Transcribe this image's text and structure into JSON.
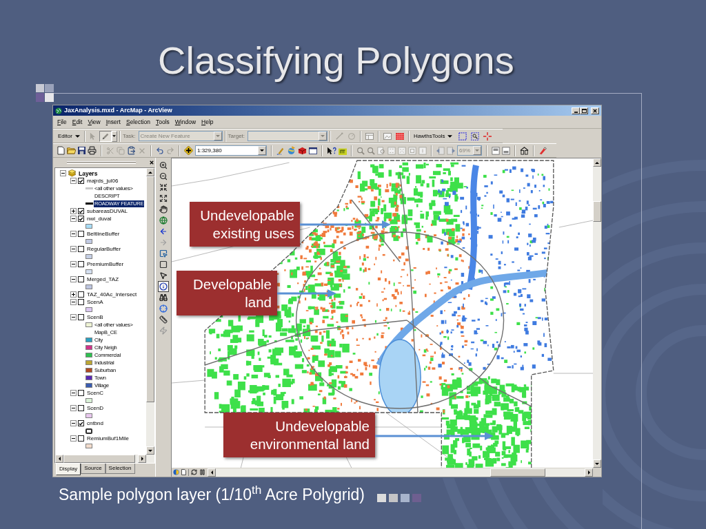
{
  "slide": {
    "title": "Classifying Polygons",
    "caption": "Sample polygon layer (1/10$^{th}$ Acre Polygrid)"
  },
  "window": {
    "title": "JaxAnalysis.mxd - ArcMap - ArcView"
  },
  "menu": [
    "File",
    "Edit",
    "View",
    "Insert",
    "Selection",
    "Tools",
    "Window",
    "Help"
  ],
  "editor_toolbar": {
    "editor": "Editor",
    "task": {
      "label": "Task:",
      "value": "Create New Feature",
      "disabled": true
    },
    "target": {
      "label": "Target:",
      "disabled": true
    },
    "hawths_tools": "HawthsTools"
  },
  "standard_toolbar": {
    "scale": "1:329,380",
    "zoom": {
      "value": "69%",
      "disabled": true
    }
  },
  "toc": {
    "root": {
      "label": "Layers",
      "expanded": true,
      "children": [
        {
          "label": "majrds_jul06",
          "checked": true,
          "expanded": true,
          "legend": [
            {
              "kind": "line",
              "label": "<all other values>",
              "color": "#c8c8c8",
              "selected": false
            },
            {
              "kind": "heading",
              "label": "DESCRIPT",
              "selected": false
            },
            {
              "kind": "line",
              "label": "ROADWAY FEATURE",
              "color": "#000000",
              "selected": true
            }
          ]
        },
        {
          "label": "subareasDUVAL",
          "checked": true,
          "expanded": false
        },
        {
          "label": "nwi_duval",
          "checked": true,
          "expanded": true,
          "legend": [
            {
              "kind": "fill",
              "color": "#a8dcf6",
              "selected": false
            }
          ]
        },
        {
          "label": "BeltlineBuffer",
          "checked": false,
          "expanded": true,
          "legend": [
            {
              "kind": "fill",
              "color": "#c2cbe4",
              "selected": false
            }
          ]
        },
        {
          "label": "RegularBuffer",
          "checked": false,
          "expanded": true,
          "legend": [
            {
              "kind": "fill",
              "color": "#c6d0e6",
              "selected": false
            }
          ]
        },
        {
          "label": "PremiumBuffer",
          "checked": false,
          "expanded": true,
          "legend": [
            {
              "kind": "fill",
              "color": "#d4dff0",
              "selected": false
            }
          ]
        },
        {
          "label": "Merged_TAZ",
          "checked": false,
          "expanded": true,
          "legend": [
            {
              "kind": "fill",
              "color": "#bdc5e0",
              "selected": false
            }
          ]
        },
        {
          "label": "TAZ_40Ac_Intersect",
          "checked": false,
          "expanded": false
        },
        {
          "label": "ScenA",
          "checked": false,
          "expanded": true,
          "legend": [
            {
              "kind": "fill",
              "color": "#dcc8f2",
              "selected": false
            }
          ]
        },
        {
          "label": "ScenB",
          "checked": false,
          "expanded": true,
          "legend": [
            {
              "kind": "fill",
              "label": "<all other values>",
              "color": "#eef3d4",
              "selected": false
            },
            {
              "kind": "heading",
              "label": "MapB_CE",
              "selected": false
            },
            {
              "kind": "fill",
              "label": "City",
              "color": "#2aa0c0",
              "selected": false
            },
            {
              "kind": "fill",
              "label": "City Neigh",
              "color": "#d0348a",
              "selected": false
            },
            {
              "kind": "fill",
              "label": "Commercial",
              "color": "#2ec050",
              "selected": false
            },
            {
              "kind": "fill",
              "label": "Industrial",
              "color": "#bca634",
              "selected": false
            },
            {
              "kind": "fill",
              "label": "Suburban",
              "color": "#b04a22",
              "selected": false
            },
            {
              "kind": "fill",
              "label": "Town",
              "color": "#5a28b4",
              "selected": false
            },
            {
              "kind": "fill",
              "label": "Village",
              "color": "#3a5cb0",
              "selected": false
            }
          ]
        },
        {
          "label": "ScenC",
          "checked": false,
          "expanded": true,
          "legend": [
            {
              "kind": "fill",
              "color": "#daf2d8",
              "selected": false
            }
          ]
        },
        {
          "label": "ScenD",
          "checked": false,
          "expanded": true,
          "legend": [
            {
              "kind": "fill",
              "color": "#e8c8ee",
              "selected": false
            }
          ]
        },
        {
          "label": "cntbnd",
          "checked": true,
          "expanded": true,
          "legend": [
            {
              "kind": "outline",
              "selected": false
            }
          ]
        },
        {
          "label": "RemiumBuf1Mile",
          "checked": false,
          "expanded": true,
          "legend": [
            {
              "kind": "fill",
              "color": "#f2dccc",
              "selected": false
            }
          ]
        }
      ]
    },
    "tabs": [
      {
        "label": "Display",
        "selected": true
      },
      {
        "label": "Source",
        "selected": false
      },
      {
        "label": "Selection",
        "selected": false
      }
    ]
  },
  "tools": [
    {
      "selected": false
    },
    {
      "selected": false
    },
    {
      "selected": false
    },
    {
      "selected": false
    },
    {
      "selected": false
    },
    {
      "selected": false
    },
    {
      "selected": false
    },
    {
      "selected": false
    },
    {
      "selected": false
    },
    {
      "selected": false
    },
    {
      "selected": false
    },
    {
      "selected": true
    },
    {
      "selected": false
    },
    {
      "selected": false
    },
    {
      "selected": false
    },
    {
      "selected": false
    }
  ],
  "callouts": [
    {
      "lines": [
        "Undevelopable",
        "existing uses"
      ]
    },
    {
      "lines": [
        "Developable",
        "land"
      ]
    },
    {
      "lines": [
        "Undevelopable",
        "environmental land"
      ]
    }
  ]
}
